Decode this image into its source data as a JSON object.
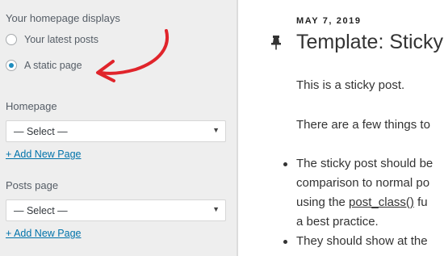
{
  "panel": {
    "homepage_displays": {
      "title": "Your homepage displays",
      "options": [
        {
          "label": "Your latest posts",
          "checked": false
        },
        {
          "label": "A static page",
          "checked": true
        }
      ]
    },
    "homepage": {
      "title": "Homepage",
      "select_value": "— Select —",
      "add_link": "+ Add New Page"
    },
    "posts_page": {
      "title": "Posts page",
      "select_value": "— Select —",
      "add_link": "+ Add New Page"
    },
    "annotation_color": "#e0242b"
  },
  "preview": {
    "date": "MAY 7, 2019",
    "title": "Template: Sticky",
    "pin_icon": "pushpin-icon",
    "paragraphs": [
      "This is a sticky post.",
      "There are a few things to"
    ],
    "bullets": [
      {
        "lines": [
          "The sticky post should be",
          "comparison to normal po",
          "using the ",
          "a best practice."
        ],
        "code_text": "post_class()",
        "after_code": " fu"
      },
      {
        "lines": [
          "They should show at the"
        ]
      }
    ]
  }
}
